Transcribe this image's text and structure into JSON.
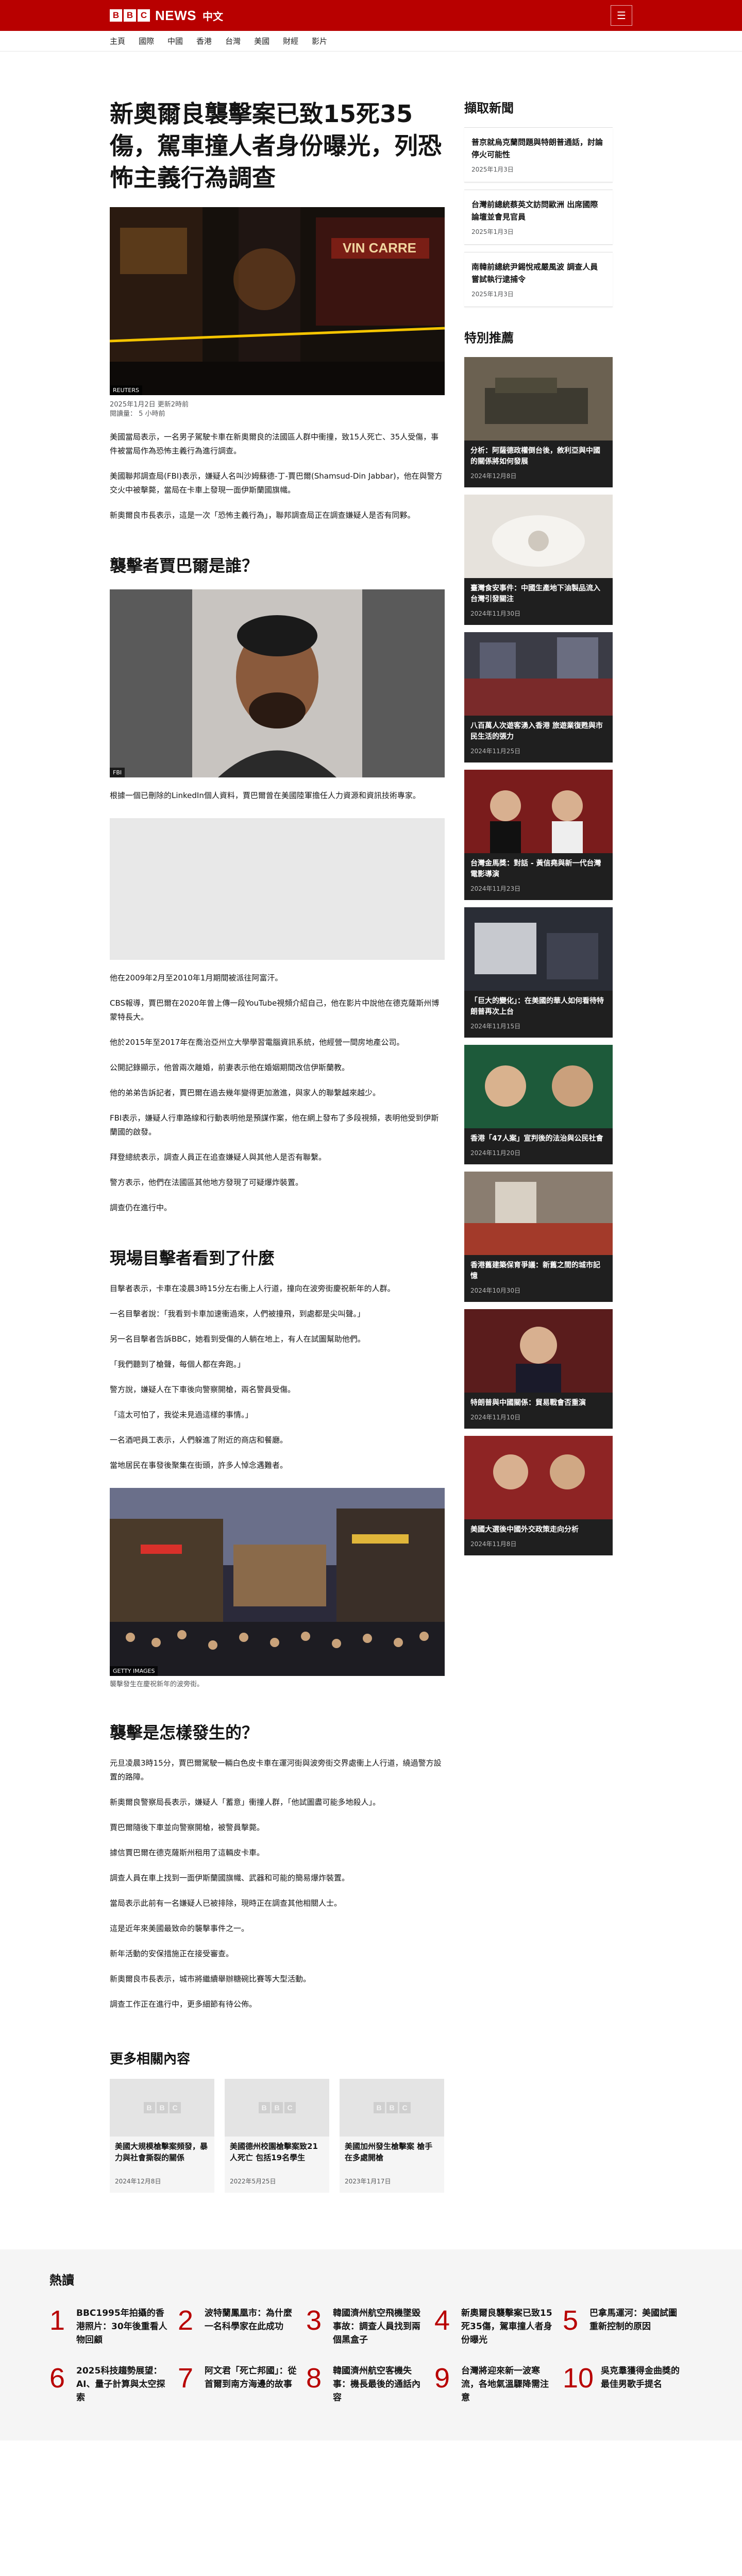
{
  "header": {
    "brand_letters": [
      "B",
      "B",
      "C"
    ],
    "brand_word": "NEWS",
    "language": "中文",
    "menu_icon": "menu-icon"
  },
  "nav": [
    "主頁",
    "國際",
    "中國",
    "香港",
    "台灣",
    "美國",
    "財經",
    "影片"
  ],
  "article": {
    "headline": "新奧爾良襲擊案已致15死35傷，駕車撞人者身份曝光，列恐怖主義行為調查",
    "hero_credit": "REUTERS",
    "published": "2025年1月2日 更新2時前",
    "read_time": "閱讀量： 5 小時前",
    "paragraphs_intro": [
      "美國當局表示，一名男子駕駛卡車在新奧爾良的法國區人群中衝撞，致15人死亡、35人受傷，事件被當局作為恐怖主義行為進行調查。",
      "美國聯邦調查局(FBI)表示，嫌疑人名叫沙姆蘇德-丁-賈巴爾(Shamsud-Din Jabbar)，他在與警方交火中被擊斃，當局在卡車上發現一面伊斯蘭國旗幟。",
      "新奧爾良市長表示，這是一次「恐怖主義行為」，聯邦調查局正在調查嫌疑人是否有同夥。"
    ],
    "h_who": "襲擊者賈巴爾是誰？",
    "who_credit": "FBI",
    "who_paragraphs": [
      "根據一個已刪除的LinkedIn個人資料，賈巴爾曾在美國陸軍擔任人力資源和資訊技術專家。",
      "他在2009年2月至2010年1月期間被派往阿富汗。"
    ],
    "who_paragraphs_2": [
      "CBS報導，賈巴爾在2020年曾上傳一段YouTube視頻介紹自己，他在影片中說他在德克薩斯州博蒙特長大。",
      "他於2015年至2017年在喬治亞州立大學學習電腦資訊系統，他經營一間房地產公司。",
      "公開記錄顯示，他曾兩次離婚，前妻表示他在婚姻期間改信伊斯蘭教。",
      "他的弟弟告訴記者，賈巴爾在過去幾年變得更加激進，與家人的聯繫越來越少。",
      "FBI表示，嫌疑人行車路線和行動表明他是預謀作案，他在網上發布了多段視頻，表明他受到伊斯蘭國的啟發。",
      "拜登總統表示，調查人員正在追查嫌疑人與其他人是否有聯繫。",
      "警方表示，他們在法國區其他地方發現了可疑爆炸裝置。",
      "調查仍在進行中。"
    ],
    "h_witness": "現場目擊者看到了什麼",
    "witness_paragraphs": [
      "目擊者表示，卡車在凌晨3時15分左右衝上人行道，撞向在波旁街慶祝新年的人群。",
      "一名目擊者說：「我看到卡車加速衝過來，人們被撞飛，到處都是尖叫聲。」",
      "另一名目擊者告訴BBC，她看到受傷的人躺在地上，有人在試圖幫助他們。",
      "「我們聽到了槍聲，每個人都在奔跑。」",
      "警方說，嫌疑人在下車後向警察開槍，兩名警員受傷。",
      "「這太可怕了，我從未見過這樣的事情。」",
      "一名酒吧員工表示，人們躲進了附近的商店和餐廳。",
      "當地居民在事發後聚集在街頭，許多人悼念遇難者。"
    ],
    "street_credit": "GETTY IMAGES",
    "street_caption": "襲擊發生在慶祝新年的波旁街。",
    "h_how": "襲擊是怎樣發生的？",
    "how_paragraphs": [
      "元旦凌晨3時15分，賈巴爾駕駛一輛白色皮卡車在運河街與波旁街交界處衝上人行道，繞過警方設置的路障。",
      "新奧爾良警察局長表示，嫌疑人「蓄意」衝撞人群，「他試圖盡可能多地殺人」。",
      "賈巴爾隨後下車並向警察開槍，被警員擊斃。",
      "據信賈巴爾在德克薩斯州租用了這輛皮卡車。",
      "調查人員在車上找到一面伊斯蘭國旗幟、武器和可能的簡易爆炸裝置。",
      "當局表示此前有一名嫌疑人已被排除，現時正在調查其他相關人士。",
      "這是近年來美國最致命的襲擊事件之一。",
      "新年活動的安保措施正在接受審查。",
      "新奧爾良市長表示，城市將繼續舉辦糖碗比賽等大型活動。",
      "調查工作正在進行中，更多細節有待公佈。"
    ]
  },
  "related": {
    "title": "更多相關內容",
    "items": [
      {
        "title": "美國大規模槍擊案頻發，暴力與社會撕裂的關係",
        "date": "2024年12月8日"
      },
      {
        "title": "美國德州校園槍擊案致21人死亡 包括19名學生",
        "date": "2022年5月25日"
      },
      {
        "title": "美國加州發生槍擊案 槍手在多處開槍",
        "date": "2023年1月17日"
      }
    ]
  },
  "sidebar": {
    "latest_title": "擷取新聞",
    "latest": [
      {
        "title": "普京就烏克蘭問題與特朗普通話，討論停火可能性",
        "date": "2025年1月3日"
      },
      {
        "title": "台灣前總統蔡英文訪問歐洲 出席國際論壇並會見官員",
        "date": "2025年1月3日"
      },
      {
        "title": "南韓前總統尹錫悅戒嚴風波 調查人員嘗試執行逮捕令",
        "date": "2025年1月3日"
      }
    ],
    "featured_title": "特別推薦",
    "featured": [
      {
        "title": "分析：阿薩德政權倒台後，敘利亞與中國的關係將如何發展",
        "date": "2024年12月8日"
      },
      {
        "title": "臺灣食安事件：中國生產地下油製品流入台灣引發關注",
        "date": "2024年11月30日"
      },
      {
        "title": "八百萬人次遊客湧入香港 旅遊業復甦與市民生活的張力",
        "date": "2024年11月25日"
      },
      {
        "title": "台灣金馬獎：對話 - 黃信堯與新一代台灣電影導演",
        "date": "2024年11月23日"
      },
      {
        "title": "「巨大的變化」：在美國的華人如何看待特朗普再次上台",
        "date": "2024年11月15日"
      },
      {
        "title": "香港「47人案」宣判後的法治與公民社會",
        "date": "2024年11月20日"
      },
      {
        "title": "香港舊建築保育爭議：新舊之間的城市記憶",
        "date": "2024年10月30日"
      },
      {
        "title": "特朗普與中國關係：貿易戰會否重演",
        "date": "2024年11月10日"
      },
      {
        "title": "美國大選後中國外交政策走向分析",
        "date": "2024年11月8日"
      }
    ]
  },
  "popular": {
    "title": "熱讀",
    "items": [
      {
        "num": "1",
        "title": "BBC1995年拍攝的香港照片：30年後重看人物回顧"
      },
      {
        "num": "2",
        "title": "波特蘭鳳凰市：為什麼一名科學家在此成功"
      },
      {
        "num": "3",
        "title": "韓國濟州航空飛機墜毀事故：調查人員找到兩個黑盒子"
      },
      {
        "num": "4",
        "title": "新奧爾良襲擊案已致15死35傷，駕車撞人者身份曝光"
      },
      {
        "num": "5",
        "title": "巴拿馬運河：美國試圖重新控制的原因"
      },
      {
        "num": "6",
        "title": "2025科技趨勢展望：AI、量子計算與太空探索"
      },
      {
        "num": "7",
        "title": "阿文君「死亡邦國」：從首爾到南方海邊的故事"
      },
      {
        "num": "8",
        "title": "韓國濟州航空客機失事：機長最後的通話內容"
      },
      {
        "num": "9",
        "title": "台灣將迎來新一波寒流，各地氣溫驟降需注意"
      },
      {
        "num": "10",
        "title": "吳克羣獲得金曲獎的最佳男歌手提名"
      }
    ]
  }
}
